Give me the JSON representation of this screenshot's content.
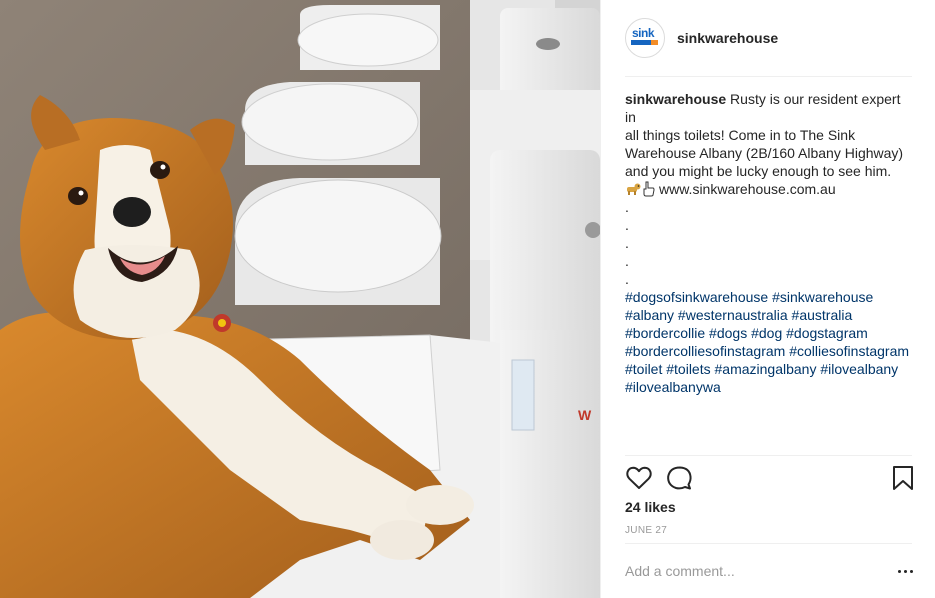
{
  "post": {
    "image_alt": "Dog sitting among toilets",
    "account": {
      "username": "sinkwarehouse",
      "avatar_logo_text": "sink"
    },
    "caption": {
      "author": "sinkwarehouse",
      "text_lines": [
        " Rusty is our resident expert in",
        "all things toilets! Come in to The Sink",
        "Warehouse Albany (2B/160 Albany Highway)",
        "and you might be lucky enough to see him."
      ],
      "link": "www.sinkwarehouse.com.au",
      "dots": [
        ".",
        ".",
        ".",
        ".",
        "."
      ],
      "hashtag_lines": [
        "#dogsofsinkwarehouse #sinkwarehouse",
        "#albany #westernaustralia #australia",
        "#bordercollie #dogs #dog #dogstagram",
        "#bordercolliesofinstagram #colliesofinstagram",
        "#toilet #toilets #amazingalbany #ilovealbany",
        "#ilovealbanywa"
      ]
    },
    "icons": {
      "like": "heart-icon",
      "comment": "comment-bubble-icon",
      "save": "bookmark-icon",
      "more": "more-options-icon"
    },
    "likes": "24 likes",
    "date": "JUNE 27",
    "comment_input": {
      "placeholder": "Add a comment...",
      "value": ""
    },
    "colors": {
      "hashtag": "#003569",
      "text": "#262626",
      "muted": "#999999",
      "brand_blue": "#1565c0",
      "brand_orange": "#f28c28"
    }
  }
}
